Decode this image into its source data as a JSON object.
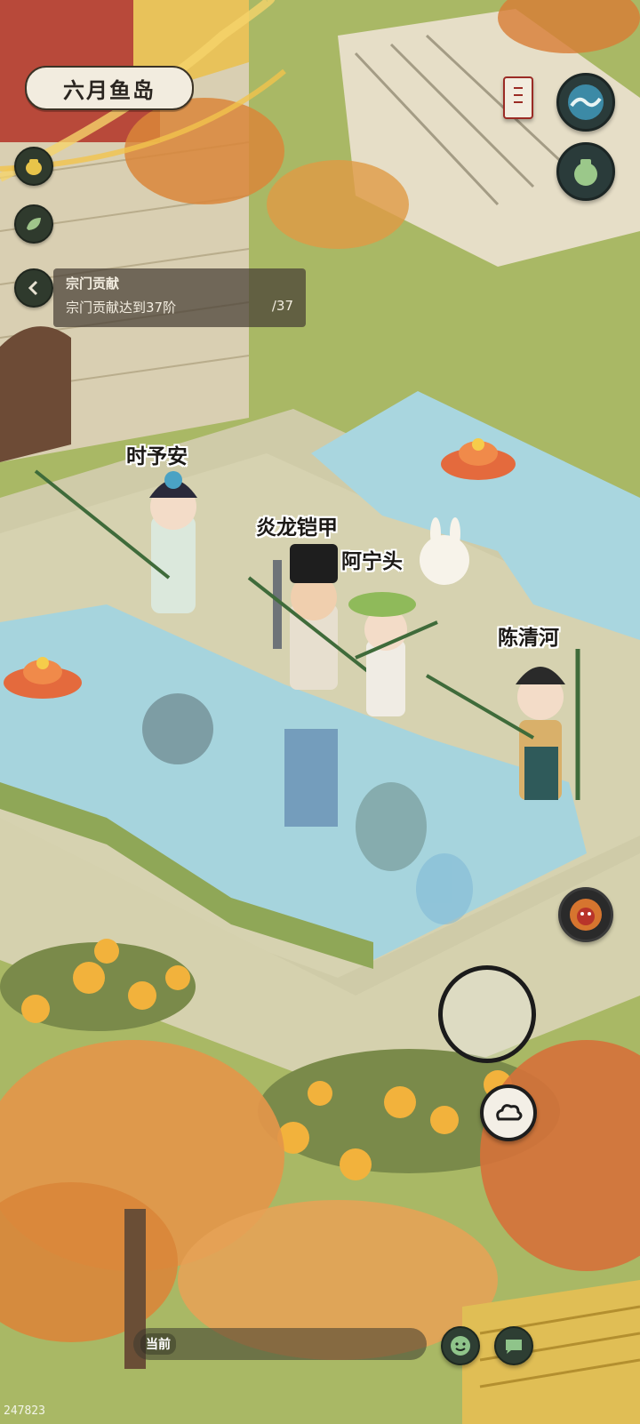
{
  "location": {
    "name": "六月鱼岛"
  },
  "quest": {
    "title": "宗门贡献",
    "description": "宗门贡献达到37阶",
    "progress_current": "",
    "progress_total": "/37"
  },
  "characters": [
    {
      "name": "时予安"
    },
    {
      "name": "炎龙铠甲"
    },
    {
      "name": "阿宁头"
    },
    {
      "name": "陈清河"
    }
  ],
  "chat": {
    "channel": "当前"
  },
  "footer": {
    "code": "247823"
  },
  "icons": {
    "gold-pot-icon": "gold-pot-icon",
    "leaf-icon": "leaf-icon",
    "collapse-icon": "chevron-left-icon",
    "wave-icon": "wave-icon",
    "bag-icon": "bag-icon",
    "scroll-icon": "scroll-icon",
    "lion-icon": "lion-icon",
    "cloud-icon": "cloud-icon",
    "emoji-icon": "emoji-icon",
    "chat-icon": "chat-icon"
  }
}
